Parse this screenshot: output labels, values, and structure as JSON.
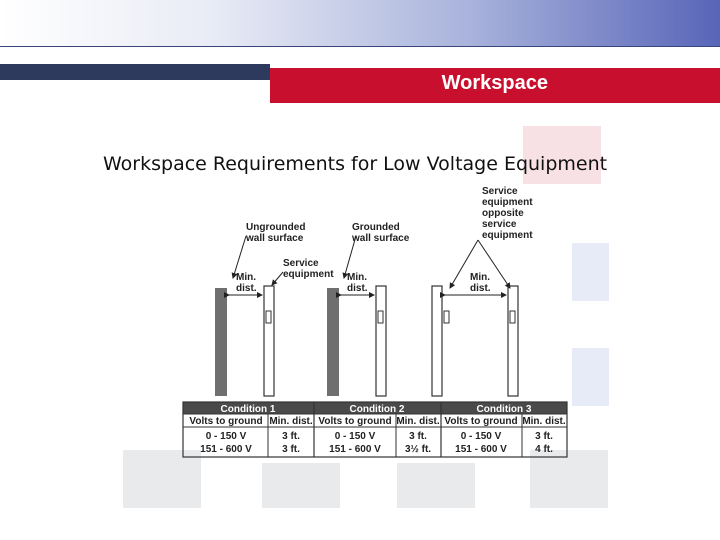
{
  "header": {
    "title": "Workspace"
  },
  "slide": {
    "heading": "Workspace Requirements for Low Voltage Equipment"
  },
  "figure": {
    "labels": {
      "ungrounded": [
        "Ungrounded",
        "wall surface"
      ],
      "grounded": [
        "Grounded",
        "wall surface"
      ],
      "service_equipment": [
        "Service",
        "equipment"
      ],
      "opposite": [
        "Service",
        "equipment",
        "opposite",
        "service",
        "equipment"
      ],
      "min_dist": [
        "Min.",
        "dist."
      ]
    },
    "table": {
      "conditions": [
        "Condition 1",
        "Condition 2",
        "Condition 3"
      ],
      "col_volts": "Volts to ground",
      "col_min": "Min. dist.",
      "rows": [
        {
          "volts": "0 - 150 V",
          "dists": [
            "3 ft.",
            "3 ft.",
            "3 ft."
          ]
        },
        {
          "volts": "151 - 600 V",
          "dists": [
            "3 ft.",
            "3½ ft.",
            "4 ft."
          ]
        }
      ]
    }
  },
  "colors": {
    "red_bar": "#c8102e",
    "navy_bar": "#2d3a5e"
  }
}
